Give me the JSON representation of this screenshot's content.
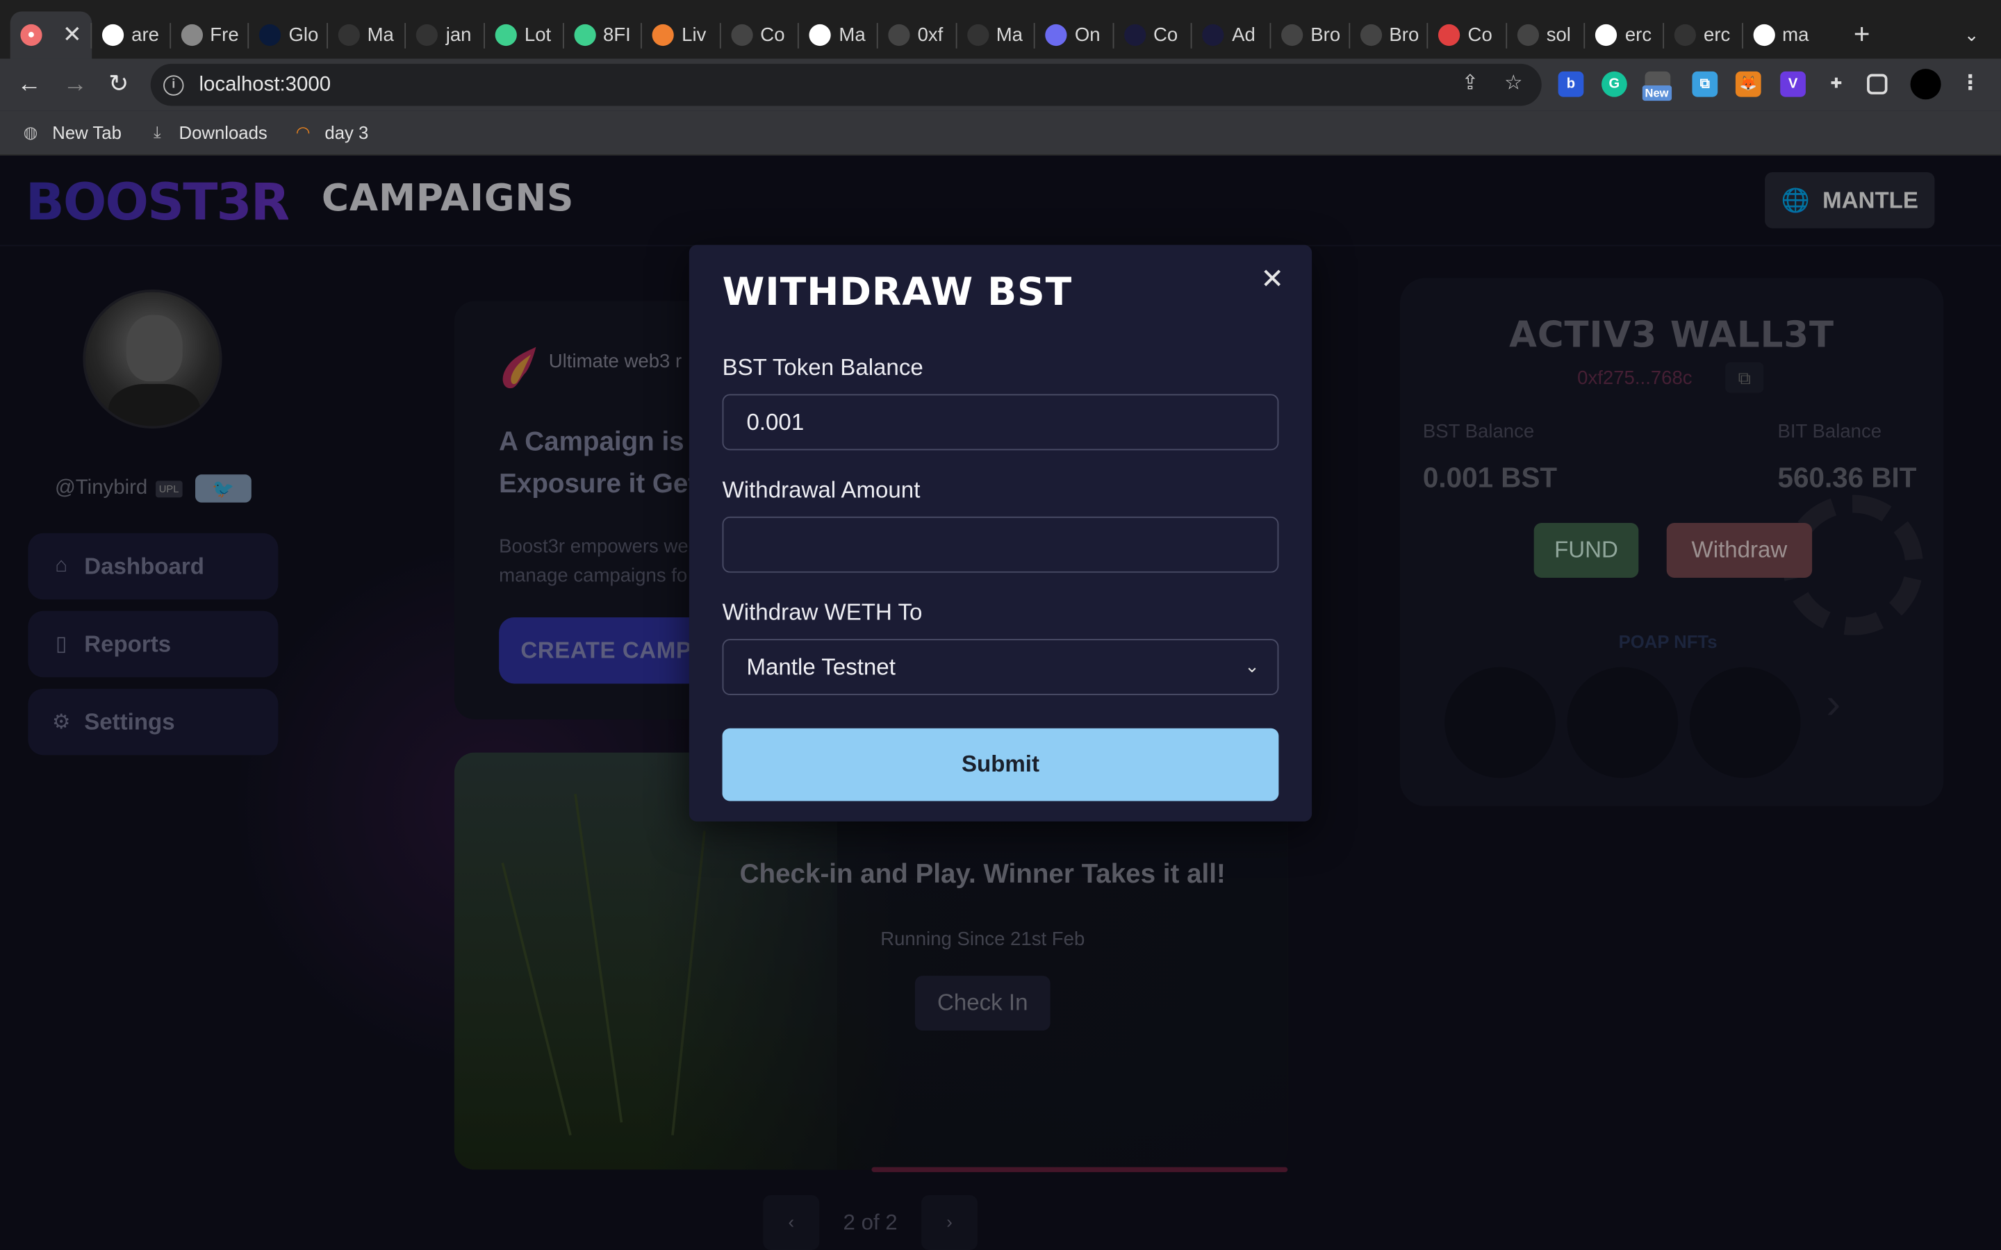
{
  "browser": {
    "tabs": [
      {
        "label": "",
        "icon": "pig-icon",
        "color": "#f07070"
      },
      {
        "label": "are",
        "icon": "google-icon",
        "color": "#ffffff"
      },
      {
        "label": "Fre",
        "icon": "globe-icon",
        "color": "#888888"
      },
      {
        "label": "Glo",
        "icon": "st-icon",
        "color": "#0a1a3a"
      },
      {
        "label": "Ma",
        "icon": "pac-icon",
        "color": "#333333"
      },
      {
        "label": "jan",
        "icon": "github-icon",
        "color": "#333333"
      },
      {
        "label": "Lot",
        "icon": "leaf-icon",
        "color": "#3ecf8e"
      },
      {
        "label": "8FI",
        "icon": "leaf-icon",
        "color": "#3ecf8e"
      },
      {
        "label": "Liv",
        "icon": "ls-icon",
        "color": "#f08030"
      },
      {
        "label": "Co",
        "icon": "burst-icon",
        "color": "#444444"
      },
      {
        "label": "Ma",
        "icon": "doc-icon",
        "color": "#ffffff"
      },
      {
        "label": "0xf",
        "icon": "burst-icon",
        "color": "#444444"
      },
      {
        "label": "Ma",
        "icon": "pac-icon",
        "color": "#333333"
      },
      {
        "label": "On",
        "icon": "circle-icon",
        "color": "#6b6bf0"
      },
      {
        "label": "Co",
        "icon": "a-icon",
        "color": "#1a1a3a"
      },
      {
        "label": "Ad",
        "icon": "a-icon",
        "color": "#1a1a3a"
      },
      {
        "label": "Bro",
        "icon": "burst-icon",
        "color": "#444444"
      },
      {
        "label": "Bro",
        "icon": "burst-icon",
        "color": "#444444"
      },
      {
        "label": "Co",
        "icon": "video-icon",
        "color": "#e04040"
      },
      {
        "label": "sol",
        "icon": "sol-icon",
        "color": "#444444"
      },
      {
        "label": "erc",
        "icon": "google-icon",
        "color": "#ffffff"
      },
      {
        "label": "erc",
        "icon": "github-icon",
        "color": "#333333"
      },
      {
        "label": "ma",
        "icon": "google-icon",
        "color": "#ffffff"
      }
    ],
    "url": "localhost:3000",
    "bookmarks": [
      {
        "label": "New Tab",
        "icon": "globe-icon"
      },
      {
        "label": "Downloads",
        "icon": "download-icon"
      },
      {
        "label": "day 3",
        "icon": "spinner-icon"
      }
    ],
    "extension_badge": "New"
  },
  "app": {
    "logo": "BOOST3R",
    "heading": "CAMPAIGNS",
    "network": "MANTLE",
    "user": {
      "handle": "@Tinybird",
      "badge": "UPL"
    },
    "nav": [
      {
        "label": "Dashboard",
        "icon": "home-icon"
      },
      {
        "label": "Reports",
        "icon": "book-icon"
      },
      {
        "label": "Settings",
        "icon": "gear-icon"
      }
    ],
    "campaign": {
      "tag": "Ultimate web3 r",
      "title_line1": "A Campaign is",
      "title_line2": "Exposure it Get",
      "desc_line1": "Boost3r empowers we",
      "desc_line2": "manage campaigns fo",
      "cta": "CREATE CAMPA"
    },
    "featured": {
      "title": "Check-in and Play. Winner Takes it all!",
      "subtitle": "Running Since 21st Feb",
      "button": "Check In"
    },
    "pager": {
      "label": "2 of 2",
      "prev": "‹",
      "next": "›"
    },
    "wallet": {
      "title": "ACTIV3 WALL3T",
      "address": "0xf275...768c",
      "bst_label": "BST Balance",
      "bst_value": "0.001 BST",
      "bit_label": "BIT Balance",
      "bit_value": "560.36 BIT",
      "fund": "FUND",
      "withdraw": "Withdraw",
      "poap_label": "POAP NFTs"
    }
  },
  "modal": {
    "title": "WITHDRAW BST",
    "balance_label": "BST Token Balance",
    "balance_value": "0.001",
    "amount_label": "Withdrawal Amount",
    "amount_value": "",
    "dest_label": "Withdraw WETH To",
    "dest_value": "Mantle Testnet",
    "submit": "Submit"
  },
  "colors": {
    "submit": "#90cdf4",
    "fund": "#41684e",
    "withdraw": "#7a4a52",
    "accent": "#3235a8"
  }
}
